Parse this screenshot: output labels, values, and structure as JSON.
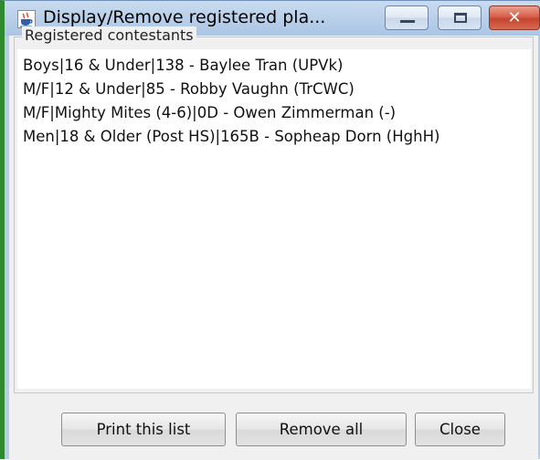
{
  "window": {
    "title": "Display/Remove registered pla...",
    "app_icon": "java-cup-icon",
    "controls": {
      "minimize_icon": "minimize-icon",
      "maximize_icon": "maximize-icon",
      "close_icon": "close-icon",
      "close_glyph": "✕"
    }
  },
  "group": {
    "title": "Registered contestants"
  },
  "contestants": [
    "Boys|16 & Under|138 - Baylee Tran (UPVk)",
    "M/F|12 & Under|85 - Robby Vaughn (TrCWC)",
    "M/F|Mighty Mites (4-6)|0D - Owen Zimmerman (-)",
    "Men|18 & Older (Post HS)|165B - Sopheap Dorn (HghH)"
  ],
  "buttons": {
    "print": "Print this list",
    "remove_all": "Remove all",
    "close": "Close"
  },
  "colors": {
    "titlebar": "#b9d0ea",
    "client_background": "#f0f0f0",
    "close_button": "#c3452f"
  }
}
